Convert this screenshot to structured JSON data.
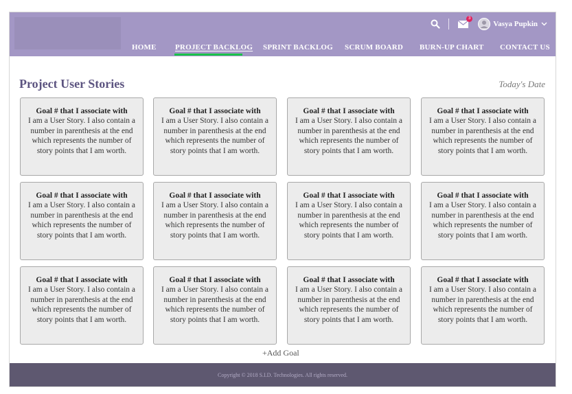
{
  "header": {
    "nav": [
      {
        "label": "HOME"
      },
      {
        "label": "PROJECT BACKLOG"
      },
      {
        "label": "SPRINT BACKLOG"
      },
      {
        "label": "SCRUM BOARD"
      },
      {
        "label": "BURN-UP CHART"
      },
      {
        "label": "CONTACT US"
      }
    ],
    "active_nav": "PROJECT BACKLOG",
    "user": {
      "name": "Vasya Pupkin"
    },
    "mail_badge": "3",
    "icons": [
      "search-icon",
      "mail-icon",
      "avatar",
      "chevron-down-icon"
    ]
  },
  "main": {
    "title": "Project User Stories",
    "date_label": "Today's Date",
    "stories": [
      {
        "title": "Goal # that I associate with",
        "body": "I am a User Story. I also contain a number in parenthesis at the end which represents the number of story points that I am worth."
      },
      {
        "title": "Goal # that I associate with",
        "body": "I am a User Story. I also contain a number in parenthesis at the end which represents the number of story points that I am worth."
      },
      {
        "title": "Goal # that I associate with",
        "body": "I am a User Story. I also contain a number in parenthesis at the end which represents the number of story points that I am worth."
      },
      {
        "title": "Goal # that I associate with",
        "body": "I am a User Story. I also contain a number in parenthesis at the end which represents the number of story points that I am worth."
      },
      {
        "title": "Goal # that I associate with",
        "body": "I am a User Story. I also contain a number in parenthesis at the end which represents the number of story points that I am worth."
      },
      {
        "title": "Goal # that I associate with",
        "body": "I am a User Story. I also contain a number in parenthesis at the end which represents the number of story points that I am worth."
      },
      {
        "title": "Goal # that I associate with",
        "body": "I am a User Story. I also contain a number in parenthesis at the end which represents the number of story points that I am worth."
      },
      {
        "title": "Goal # that I associate with",
        "body": "I am a User Story. I also contain a number in parenthesis at the end which represents the number of story points that I am worth."
      },
      {
        "title": "Goal # that I associate with",
        "body": "I am a User Story. I also contain a number in parenthesis at the end which represents the number of story points that I am worth."
      },
      {
        "title": "Goal # that I associate with",
        "body": "I am a User Story. I also contain a number in parenthesis at the end which represents the number of story points that I am worth."
      },
      {
        "title": "Goal # that I associate with",
        "body": "I am a User Story. I also contain a number in parenthesis at the end which represents the number of story points that I am worth."
      },
      {
        "title": "Goal # that I associate with",
        "body": "I am a User Story. I also contain a number in parenthesis at the end which represents the number of story points that I am worth."
      }
    ],
    "add_goal_label": "+Add Goal"
  },
  "footer": {
    "copyright": "Copyright © 2018 S.I.D. Technologies. All rights reserved."
  },
  "colors": {
    "header_bg": "#a397c5",
    "active_underline": "#19c34a",
    "title": "#5c5480",
    "footer_bg": "#5e5870",
    "badge": "#e0245e"
  }
}
